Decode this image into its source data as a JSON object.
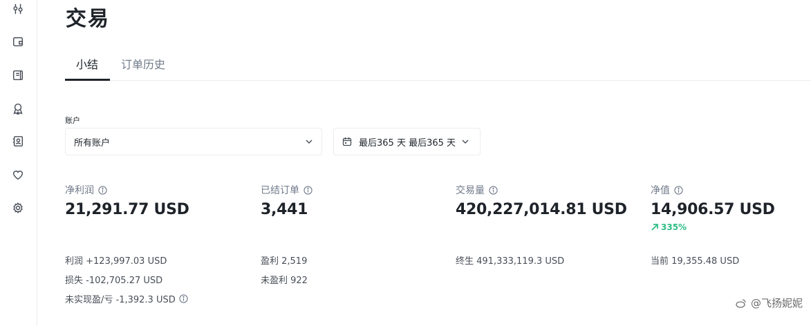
{
  "sidebar": {
    "icons": [
      "tune-icon",
      "wallet-icon",
      "orders-icon",
      "award-icon",
      "profile-card-icon",
      "heart-icon",
      "gear-icon"
    ]
  },
  "page": {
    "title": "交易"
  },
  "tabs": [
    {
      "label": "小结",
      "active": true
    },
    {
      "label": "订单历史",
      "active": false
    }
  ],
  "filters": {
    "account_label": "账户",
    "account_value": "所有账户",
    "date_range": "最后365 天 最后365 天"
  },
  "stats": {
    "net_profit": {
      "label": "净利润",
      "value": "21,291.77 USD"
    },
    "closed_orders": {
      "label": "已结订单",
      "value": "3,441"
    },
    "volume": {
      "label": "交易量",
      "value": "420,227,014.81 USD"
    },
    "equity": {
      "label": "净值",
      "value": "14,906.57 USD",
      "growth": "335%"
    }
  },
  "details": {
    "profit": "利润 +123,997.03 USD",
    "loss": "损失 -102,705.27 USD",
    "unrealized": "未实现盈/亏 -1,392.3 USD",
    "winning": "盈利 2,519",
    "losing": "未盈利 922",
    "lifetime": "终生 491,333,119.3 USD",
    "current": "当前 19,355.48 USD"
  },
  "watermark": "@飞扬妮妮",
  "colors": {
    "accent_green": "#2ebd85",
    "text_primary": "#1e2329",
    "text_secondary": "#707a8a"
  }
}
